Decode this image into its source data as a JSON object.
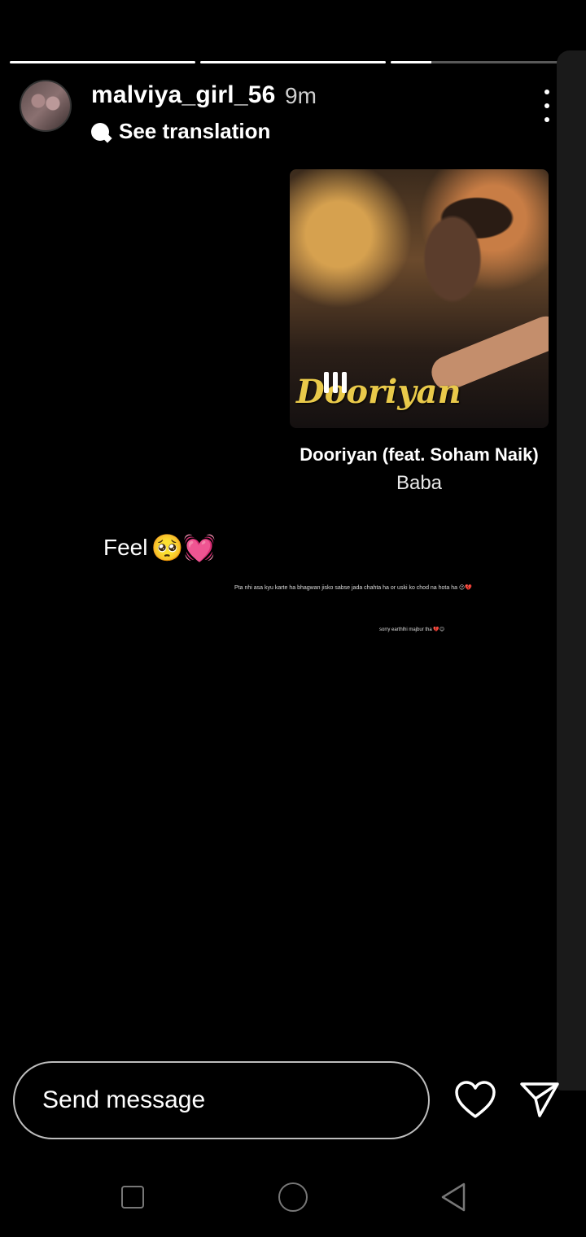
{
  "story": {
    "progress": [
      1.0,
      1.0,
      0.22
    ],
    "username": "malviya_girl_56",
    "time": "9m",
    "translate_label": "See translation"
  },
  "music": {
    "cover_text": "Dooriyan",
    "title": "Dooriyan (feat. Soham Naik)",
    "artist": "Baba"
  },
  "caption": {
    "text": "Feel",
    "emojis": "🥺💓",
    "small_text_1": "Pta nhi asa kyu karte ha bhagwan jisko sabse jada chahta ha or uski ko chod na hota ha 😕💔",
    "small_text_2": "sorry earthlhi majbur tha 💔😊"
  },
  "reply": {
    "placeholder": "Send message"
  },
  "icons": {
    "like": "heart-outline-icon",
    "send": "paper-plane-icon",
    "more": "vertical-dots-icon"
  },
  "colors": {
    "background": "#000000",
    "cover_title": "#e9c94a"
  }
}
